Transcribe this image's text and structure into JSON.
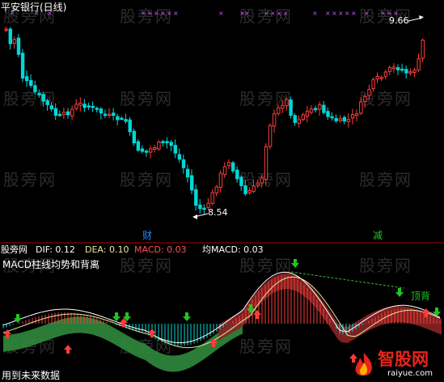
{
  "title": "平安银行(日线)",
  "price_annotations": {
    "high": "9.66",
    "low": "8.54"
  },
  "markers": {
    "cai": "财",
    "jian": "减"
  },
  "indicator": {
    "prefix": "股旁网",
    "dif": "DIF: 0.12",
    "dea": "DEA: 0.10",
    "macd": "MACD: 0.03",
    "avg": "均MACD: 0.03",
    "subtitle": "MACD柱线均势和背离",
    "divergence_label": "顶背"
  },
  "watermark": "股旁网",
  "logo": {
    "name": "智股网",
    "url": "raiyue.com"
  },
  "footer": "用到未来数据",
  "colors": {
    "up": "#ff3c3c",
    "down": "#00d8d8",
    "dif": "#ffffff",
    "dea": "#e8e8a0",
    "ribbon_green": "#2f8a3c",
    "ribbon_red": "#8a2424",
    "divider": "#b00000",
    "arrow_up": "#ff3c3c",
    "arrow_down": "#22c422"
  }
}
